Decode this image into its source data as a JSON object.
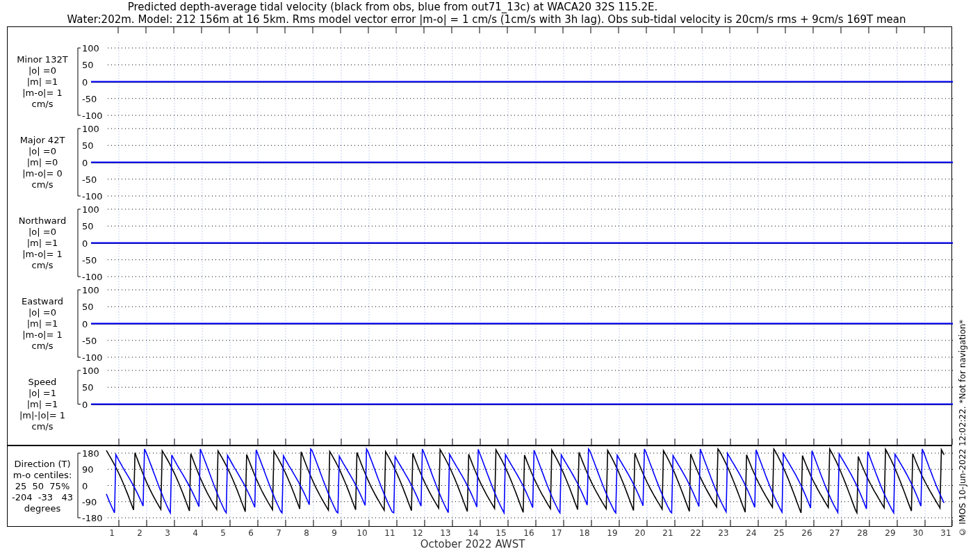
{
  "title_lines": [
    "Predicted depth-average tidal velocity (black from obs, blue from out71_13c) at WACA20 32S 115.2E.",
    "Water:202m. Model: 212 156m at 16 5km. Rms model vector error |m-o| = 1 cm/s (1cm/s with 3h lag). Obs sub-tidal velocity is 20cm/s rms + 9cm/s 169T mean"
  ],
  "panels": [
    {
      "label_lines": [
        "Minor 132T",
        "|o| =0",
        "|m| =1",
        "|m-o|= 1",
        "cm/s"
      ],
      "yticks": [
        "100",
        "50",
        "0",
        "-50",
        "-100"
      ]
    },
    {
      "label_lines": [
        "Major 42T",
        "|o| =0",
        "|m| =0",
        "|m-o|= 0",
        "cm/s"
      ],
      "yticks": [
        "100",
        "50",
        "0",
        "-50",
        "-100"
      ]
    },
    {
      "label_lines": [
        "Northward",
        "|o| =0",
        "|m| =1",
        "|m-o|= 1",
        "cm/s"
      ],
      "yticks": [
        "100",
        "50",
        "0",
        "-50",
        "-100"
      ]
    },
    {
      "label_lines": [
        "Eastward",
        "|o| =0",
        "|m| =1",
        "|m-o|= 1",
        "cm/s"
      ],
      "yticks": [
        "100",
        "50",
        "0",
        "-50",
        "-100"
      ]
    },
    {
      "label_lines": [
        "Speed",
        "|o| =1",
        "|m| =1",
        "|m|-|o|= 1",
        "cm/s"
      ],
      "yticks": [
        "100",
        "50",
        "0"
      ]
    }
  ],
  "direction": {
    "label_lines": [
      "Direction (T)",
      "m-o centiles:",
      "25  50  75%",
      "-204  -33   43",
      "degrees"
    ],
    "yticks": [
      "180",
      "90",
      "0",
      "-90",
      "-180"
    ]
  },
  "days": [
    "1",
    "2",
    "3",
    "4",
    "5",
    "6",
    "7",
    "8",
    "9",
    "10",
    "11",
    "12",
    "13",
    "14",
    "15",
    "16",
    "17",
    "18",
    "19",
    "20",
    "21",
    "22",
    "23",
    "24",
    "25",
    "26",
    "27",
    "28",
    "29",
    "30",
    "31"
  ],
  "xlabel": "October 2022 AWST",
  "credit": "© IMOS 10-Jun-2022 12:02:22. *Not for navigation*"
}
